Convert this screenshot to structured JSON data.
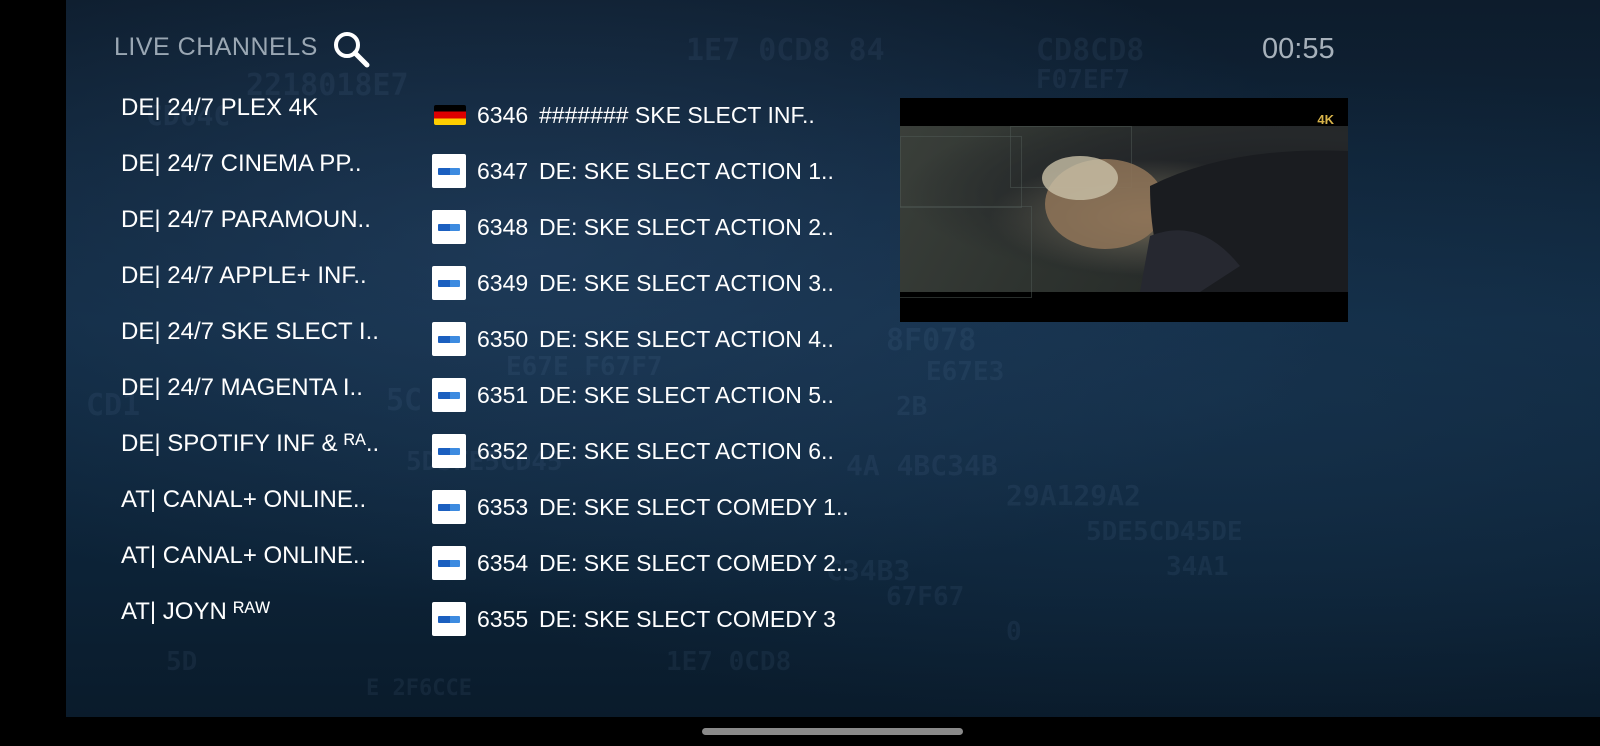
{
  "header": {
    "title": "LIVE CHANNELS",
    "clock": "00:55"
  },
  "categories": [
    "DE| 24/7 PLEX 4K",
    "DE| 24/7 CINEMA PP..",
    "DE| 24/7 PARAMOUN..",
    "DE| 24/7 APPLE+ INF..",
    "DE| 24/7 SKE SLECT I..",
    "DE| 24/7 MAGENTA I..",
    "DE| SPOTIFY INF & ᴿᴬ..",
    "AT| CANAL+ ONLINE..",
    "AT| CANAL+ ONLINE..",
    "AT| JOYN ᴿᴬᵂ"
  ],
  "channels": [
    {
      "number": "6346",
      "name": "####### SKE SLECT INF..",
      "logo": "germany-flag-icon"
    },
    {
      "number": "6347",
      "name": "DE: SKE SLECT ACTION 1..",
      "logo": "channel-logo-icon"
    },
    {
      "number": "6348",
      "name": "DE: SKE SLECT ACTION 2..",
      "logo": "channel-logo-icon"
    },
    {
      "number": "6349",
      "name": "DE: SKE SLECT ACTION 3..",
      "logo": "channel-logo-icon"
    },
    {
      "number": "6350",
      "name": "DE: SKE SLECT ACTION 4..",
      "logo": "channel-logo-icon"
    },
    {
      "number": "6351",
      "name": "DE: SKE SLECT ACTION 5..",
      "logo": "channel-logo-icon"
    },
    {
      "number": "6352",
      "name": "DE: SKE SLECT ACTION 6..",
      "logo": "channel-logo-icon"
    },
    {
      "number": "6353",
      "name": "DE: SKE SLECT COMEDY 1..",
      "logo": "channel-logo-icon"
    },
    {
      "number": "6354",
      "name": "DE: SKE SLECT COMEDY 2..",
      "logo": "channel-logo-icon"
    },
    {
      "number": "6355",
      "name": "DE: SKE SLECT COMEDY 3",
      "logo": "channel-logo-icon"
    }
  ],
  "preview": {
    "badge": "4K"
  },
  "colors": {
    "background": "#0f2538",
    "text": "#ffffff",
    "header_text": "#9aa7b3",
    "badge": "#d9b44a"
  }
}
